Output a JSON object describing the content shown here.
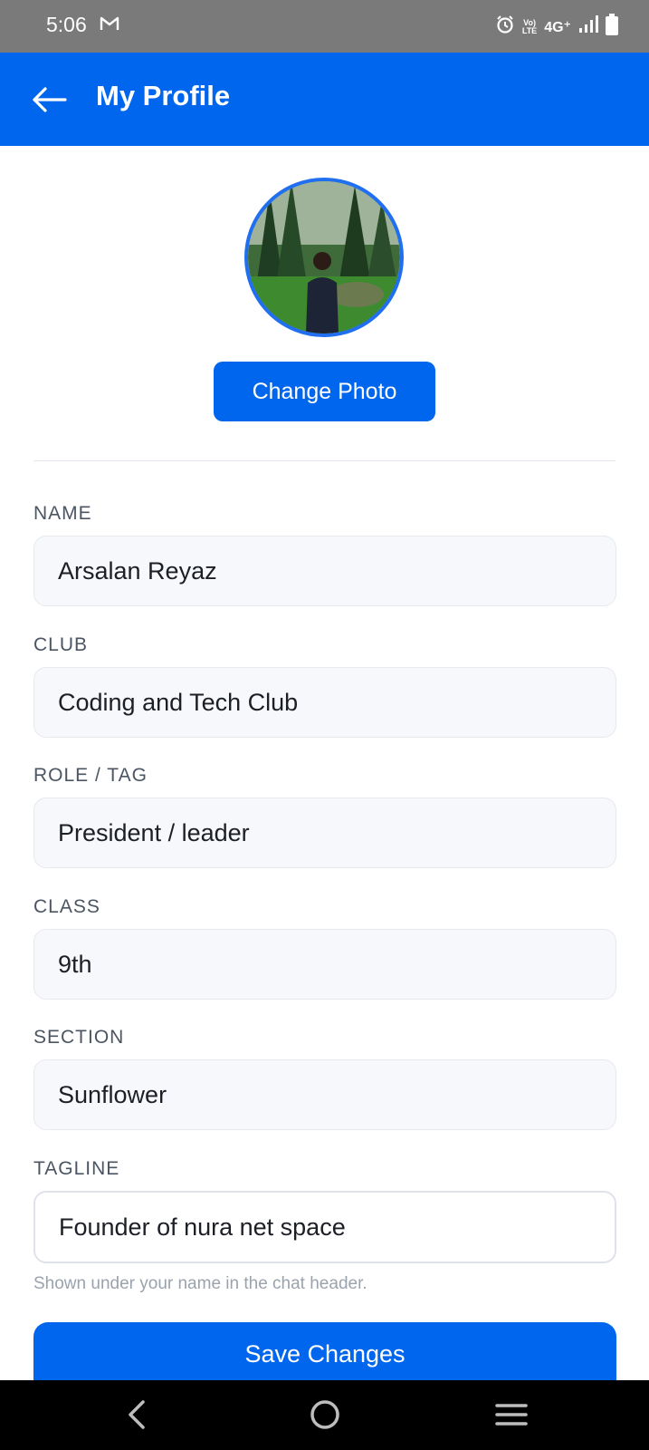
{
  "status_bar": {
    "time": "5:06",
    "network": "4G⁺",
    "volte_line1": "Vo)",
    "volte_line2": "LTE"
  },
  "app_bar": {
    "title": "My Profile",
    "back_icon": "arrow-left-icon"
  },
  "profile": {
    "change_photo_label": "Change Photo"
  },
  "form": {
    "fields": [
      {
        "label": "NAME",
        "value": "Arsalan Reyaz"
      },
      {
        "label": "CLUB",
        "value": "Coding and Tech Club"
      },
      {
        "label": "ROLE / TAG",
        "value": "President / leader"
      },
      {
        "label": "CLASS",
        "value": "9th"
      },
      {
        "label": "SECTION",
        "value": "Sunflower"
      },
      {
        "label": "TAGLINE",
        "value": "Founder of nura net space"
      }
    ],
    "tagline_hint": "Shown under your name in the chat header.",
    "save_label": "Save Changes"
  },
  "colors": {
    "accent": "#0066ee",
    "status_bar": "#7a7a7a",
    "label": "#4b5563",
    "hint": "#9aa3ad"
  }
}
